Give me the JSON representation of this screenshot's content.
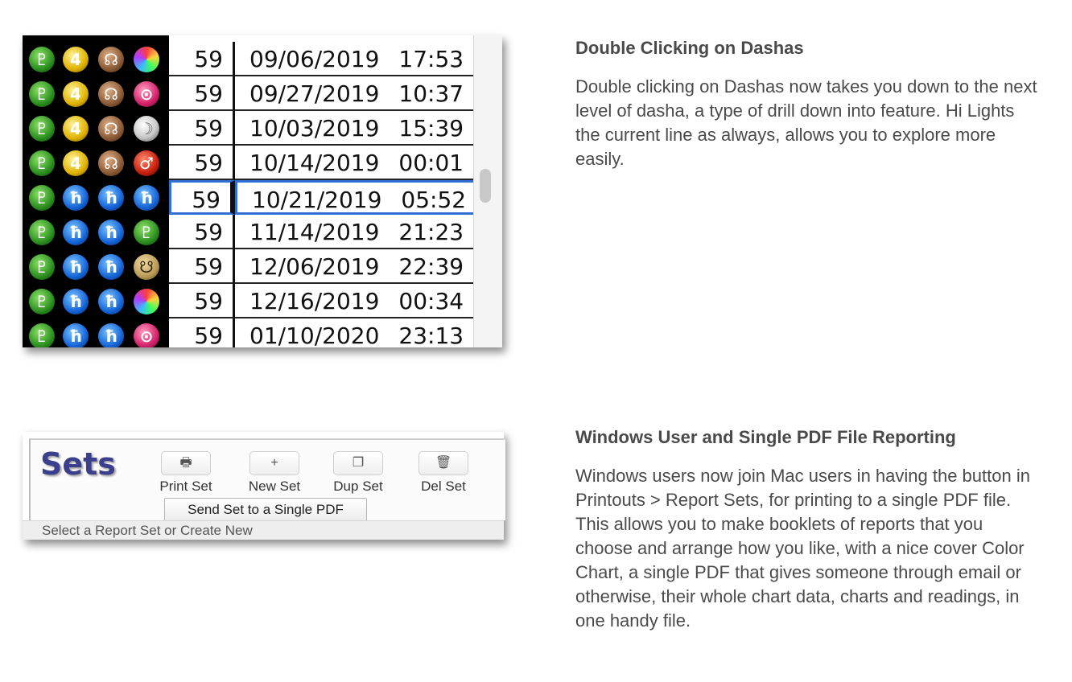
{
  "dasha_table": {
    "rows": [
      {
        "num": "59",
        "date": "09/06/2019",
        "time": "17:53",
        "icons": [
          {
            "name": "pluto",
            "glyph": "♇",
            "style": "green"
          },
          {
            "name": "jupiter",
            "glyph": "4",
            "style": "yellow"
          },
          {
            "name": "rahu",
            "glyph": "☊",
            "style": "brown"
          },
          {
            "name": "venus",
            "glyph": "",
            "style": "rainbow"
          }
        ]
      },
      {
        "num": "59",
        "date": "09/27/2019",
        "time": "10:37",
        "icons": [
          {
            "name": "pluto",
            "glyph": "♇",
            "style": "green"
          },
          {
            "name": "jupiter",
            "glyph": "4",
            "style": "yellow"
          },
          {
            "name": "rahu",
            "glyph": "☊",
            "style": "brown"
          },
          {
            "name": "sun",
            "glyph": "⊙",
            "style": "pink"
          }
        ]
      },
      {
        "num": "59",
        "date": "10/03/2019",
        "time": "15:39",
        "icons": [
          {
            "name": "pluto",
            "glyph": "♇",
            "style": "green"
          },
          {
            "name": "jupiter",
            "glyph": "4",
            "style": "yellow"
          },
          {
            "name": "rahu",
            "glyph": "☊",
            "style": "brown"
          },
          {
            "name": "moon",
            "glyph": "☽",
            "style": "pearl"
          }
        ]
      },
      {
        "num": "59",
        "date": "10/14/2019",
        "time": "00:01",
        "icons": [
          {
            "name": "pluto",
            "glyph": "♇",
            "style": "green"
          },
          {
            "name": "jupiter",
            "glyph": "4",
            "style": "yellow"
          },
          {
            "name": "rahu",
            "glyph": "☊",
            "style": "brown"
          },
          {
            "name": "mars",
            "glyph": "♂",
            "style": "red"
          }
        ]
      },
      {
        "num": "59",
        "date": "10/21/2019",
        "time": "05:52",
        "selected": true,
        "icons": [
          {
            "name": "pluto",
            "glyph": "♇",
            "style": "green"
          },
          {
            "name": "saturn",
            "glyph": "ħ",
            "style": "blue"
          },
          {
            "name": "saturn",
            "glyph": "ħ",
            "style": "blue"
          },
          {
            "name": "saturn",
            "glyph": "ħ",
            "style": "blue"
          }
        ]
      },
      {
        "num": "59",
        "date": "11/14/2019",
        "time": "21:23",
        "icons": [
          {
            "name": "pluto",
            "glyph": "♇",
            "style": "green"
          },
          {
            "name": "saturn",
            "glyph": "ħ",
            "style": "blue"
          },
          {
            "name": "saturn",
            "glyph": "ħ",
            "style": "blue"
          },
          {
            "name": "pluto",
            "glyph": "♇",
            "style": "green"
          }
        ]
      },
      {
        "num": "59",
        "date": "12/06/2019",
        "time": "22:39",
        "icons": [
          {
            "name": "pluto",
            "glyph": "♇",
            "style": "green"
          },
          {
            "name": "saturn",
            "glyph": "ħ",
            "style": "blue"
          },
          {
            "name": "saturn",
            "glyph": "ħ",
            "style": "blue"
          },
          {
            "name": "ketu",
            "glyph": "☋",
            "style": "tan"
          }
        ]
      },
      {
        "num": "59",
        "date": "12/16/2019",
        "time": "00:34",
        "icons": [
          {
            "name": "pluto",
            "glyph": "♇",
            "style": "green"
          },
          {
            "name": "saturn",
            "glyph": "ħ",
            "style": "blue"
          },
          {
            "name": "saturn",
            "glyph": "ħ",
            "style": "blue"
          },
          {
            "name": "venus",
            "glyph": "",
            "style": "rainbow"
          }
        ]
      },
      {
        "num": "59",
        "date": "01/10/2020",
        "time": "23:13",
        "icons": [
          {
            "name": "pluto",
            "glyph": "♇",
            "style": "green"
          },
          {
            "name": "saturn",
            "glyph": "ħ",
            "style": "blue"
          },
          {
            "name": "saturn",
            "glyph": "ħ",
            "style": "blue"
          },
          {
            "name": "sun",
            "glyph": "⊙",
            "style": "pink"
          }
        ]
      }
    ],
    "selection_color": "#2f6fd6"
  },
  "sets_toolbar": {
    "title": "Sets",
    "buttons": [
      {
        "label": "Print Set",
        "icon": "printer-icon",
        "glyph": "🖶"
      },
      {
        "label": "New Set",
        "icon": "plus-icon",
        "glyph": "+"
      },
      {
        "label": "Dup Set",
        "icon": "duplicate-icon",
        "glyph": "❐"
      },
      {
        "label": "Del Set",
        "icon": "trash-icon",
        "glyph": "🗑"
      }
    ],
    "pdf_button": "Send Set to a Single PDF",
    "status": "Select a Report Set or Create New",
    "title_color": "#3b3f8c"
  },
  "sections": [
    {
      "heading": "Double Clicking on Dashas",
      "body": "Double clicking on Dashas now takes you down to the next level of dasha, a type of drill down into feature. Hi Lights the current line as always, allows you to explore more easily."
    },
    {
      "heading": "Windows User and Single PDF File Reporting",
      "body": "Windows users now join Mac users in having the button in Printouts > Report Sets, for printing to a single PDF file. This allows you to make booklets of reports that you choose and arrange how you like, with a nice cover Color Chart, a single PDF that gives someone through email or otherwise, their whole chart data, charts and readings, in one handy file."
    }
  ]
}
